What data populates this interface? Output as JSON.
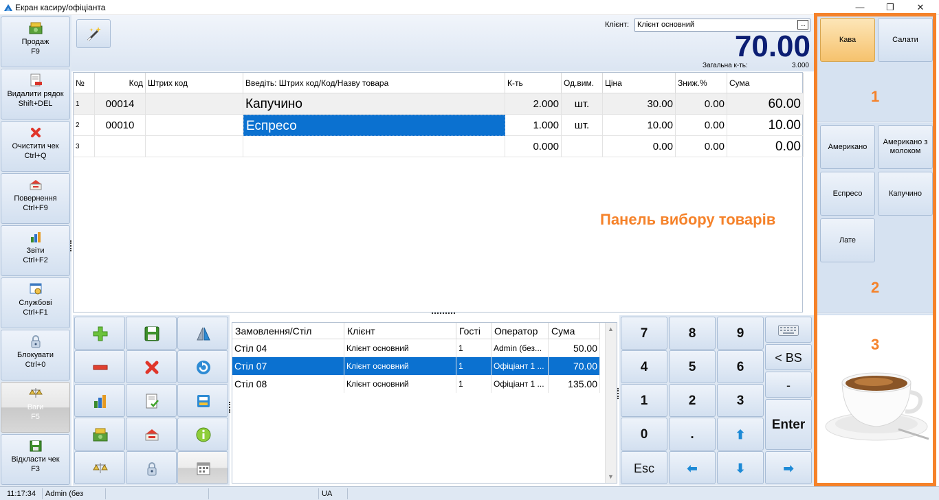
{
  "window": {
    "title": "Екран касиру/офіціанта",
    "controls": [
      "—",
      "❐",
      "✕"
    ]
  },
  "sidebar": {
    "items": [
      {
        "name": "sale",
        "label": "Продаж",
        "shortcut": "F9",
        "icon": "cash-icon"
      },
      {
        "name": "delete-row",
        "label": "Видалити рядок",
        "shortcut": "Shift+DEL",
        "icon": "delete-row-icon"
      },
      {
        "name": "clear-check",
        "label": "Очистити чек",
        "shortcut": "Ctrl+Q",
        "icon": "clear-icon"
      },
      {
        "name": "return",
        "label": "Повернення",
        "shortcut": "Ctrl+F9",
        "icon": "return-icon"
      },
      {
        "name": "reports",
        "label": "Звіти",
        "shortcut": "Ctrl+F2",
        "icon": "reports-icon"
      },
      {
        "name": "service",
        "label": "Службові",
        "shortcut": "Ctrl+F1",
        "icon": "service-icon"
      },
      {
        "name": "lock",
        "label": "Блокувати",
        "shortcut": "Ctrl+0",
        "icon": "lock-icon"
      },
      {
        "name": "scales",
        "label": "Ваги",
        "shortcut": "F5",
        "icon": "scales-icon",
        "disabled": true
      },
      {
        "name": "defer-check",
        "label": "Відкласти чек",
        "shortcut": "F3",
        "icon": "defer-icon"
      }
    ]
  },
  "header": {
    "client_label": "Клієнт:",
    "client_value": "Клієнт основний",
    "client_pick": "...",
    "total": "70.00",
    "qty_label": "Загальна к-ть:",
    "qty_value": "3.000"
  },
  "grid": {
    "columns": [
      "№",
      "Код",
      "Штрих код",
      "Введіть: Штрих код/Код/Назву товара",
      "К-ть",
      "Од.вим.",
      "Ціна",
      "Зниж.%",
      "Сума"
    ],
    "rows": [
      {
        "n": "1",
        "code": "00014",
        "barcode": "",
        "name": "Капучино",
        "qty": "2.000",
        "unit": "шт.",
        "price": "30.00",
        "discount": "0.00",
        "sum": "60.00"
      },
      {
        "n": "2",
        "code": "00010",
        "barcode": "",
        "name": "Еспресо",
        "qty": "1.000",
        "unit": "шт.",
        "price": "10.00",
        "discount": "0.00",
        "sum": "10.00"
      },
      {
        "n": "3",
        "code": "",
        "barcode": "",
        "name": "",
        "qty": "0.000",
        "unit": "",
        "price": "0.00",
        "discount": "0.00",
        "sum": "0.00"
      }
    ],
    "selected_row": 1,
    "caption": "Панель вибору товарів"
  },
  "func_grid": {
    "icons": [
      "plus-icon",
      "save-icon",
      "mirror-icon",
      "minus-icon",
      "delete-icon",
      "refresh-icon",
      "chart-icon",
      "checklist-icon",
      "terminal-icon",
      "cash-icon",
      "return-icon",
      "info-icon",
      "scales-icon",
      "lock-icon",
      "calendar-icon"
    ]
  },
  "orders": {
    "columns": [
      "Замовлення/Стіл",
      "Клієнт",
      "Гості",
      "Оператор",
      "Сума"
    ],
    "rows": [
      {
        "table": "Стіл 04",
        "client": "Клієнт основний",
        "guests": "1",
        "operator": "Admin (без...",
        "sum": "50.00"
      },
      {
        "table": "Стіл 07",
        "client": "Клієнт основний",
        "guests": "1",
        "operator": "Офіціант 1 ...",
        "sum": "70.00"
      },
      {
        "table": "Стіл 08",
        "client": "Клієнт основний",
        "guests": "1",
        "operator": "Офіціант 1 ...",
        "sum": "135.00"
      }
    ],
    "selected_row": 1
  },
  "numpad": {
    "digits": [
      "7",
      "8",
      "9",
      "4",
      "5",
      "6",
      "1",
      "2",
      "3",
      "0",
      "."
    ],
    "backspace": "< BS",
    "minus": "-",
    "enter": "Enter",
    "esc": "Esc",
    "keyboard_icon": "keyboard-icon"
  },
  "products": {
    "groups": [
      {
        "label": "Кава",
        "active": true
      },
      {
        "label": "Салати",
        "active": false
      }
    ],
    "items": [
      "Американо",
      "Американо з молоком",
      "Еспресо",
      "Капучино",
      "Лате"
    ],
    "zone_labels": [
      "1",
      "2",
      "3"
    ],
    "image_icon": "espresso-cup-icon"
  },
  "statusbar": {
    "time": "11:17:34",
    "user": "Admin (без",
    "lang": "UA"
  }
}
